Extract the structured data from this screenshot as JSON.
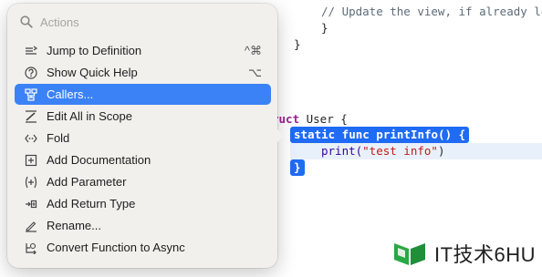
{
  "editor": {
    "lines": {
      "update_comment": "// Update the view, if already lo",
      "brace_inner": "}",
      "brace_outer": "}",
      "struct_kw": "ruct",
      "struct_name": " User {",
      "func_line": "static func printInfo() {",
      "print_kw": "print(",
      "print_str": "\"test info\"",
      "print_close": ")",
      "func_close": "}"
    }
  },
  "menu": {
    "search_placeholder": "Actions",
    "items": [
      {
        "label": "Jump to Definition",
        "icon": "jump-icon",
        "shortcut": "^⌘"
      },
      {
        "label": "Show Quick Help",
        "icon": "question-icon",
        "shortcut": "⌥"
      },
      {
        "label": "Callers...",
        "icon": "callers-icon",
        "shortcut": ""
      },
      {
        "label": "Edit All in Scope",
        "icon": "edit-scope-icon",
        "shortcut": ""
      },
      {
        "label": "Fold",
        "icon": "fold-icon",
        "shortcut": ""
      },
      {
        "label": "Add Documentation",
        "icon": "add-doc-icon",
        "shortcut": ""
      },
      {
        "label": "Add Parameter",
        "icon": "add-param-icon",
        "shortcut": ""
      },
      {
        "label": "Add Return Type",
        "icon": "add-return-icon",
        "shortcut": ""
      },
      {
        "label": "Rename...",
        "icon": "rename-icon",
        "shortcut": ""
      },
      {
        "label": "Convert Function to Async",
        "icon": "async-icon",
        "shortcut": ""
      }
    ],
    "selected_index": 2
  },
  "watermark": {
    "text": "IT技术6HU"
  },
  "colors": {
    "selection": "#3b82f7",
    "code_selection": "#1f6bf5",
    "menu_bg": "#f2f0ed"
  }
}
